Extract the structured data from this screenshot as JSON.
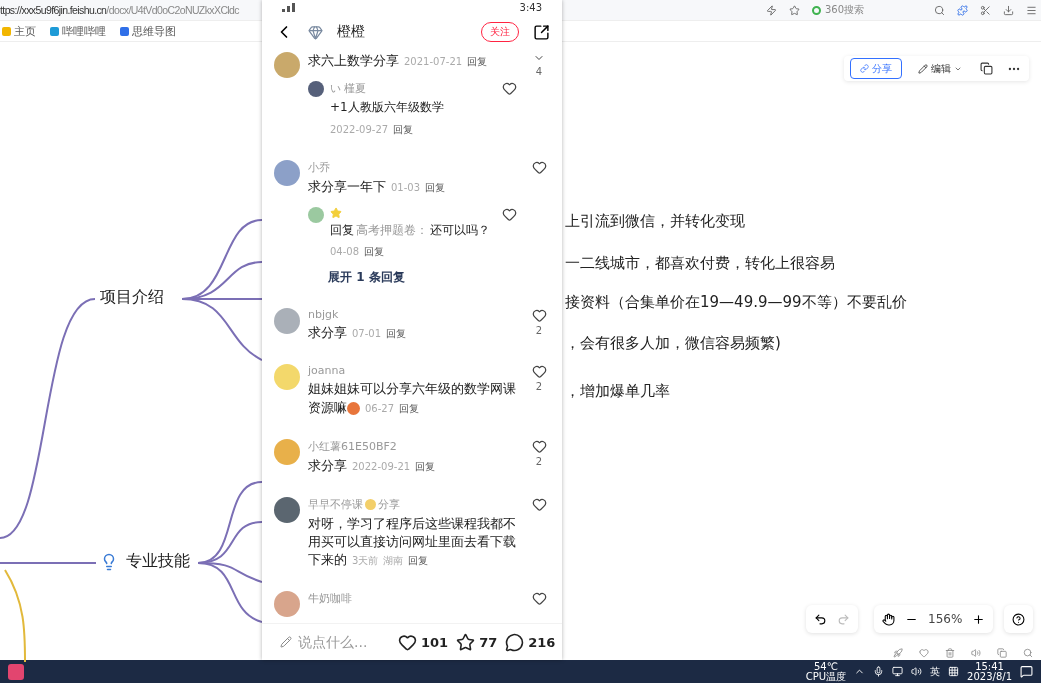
{
  "browser": {
    "url_host": "ttps://xxx5u9f6jin.feishu.cn",
    "url_path": "/docx/U4tVd0oC2oNUZkxXCldc",
    "search": "360搜索"
  },
  "bookmarks": [
    {
      "label": "主页",
      "color": "#f2b600"
    },
    {
      "label": "哔哩哔哩",
      "color": "#1e9bd7"
    },
    {
      "label": "思维导图",
      "color": "#2f6fe8"
    }
  ],
  "doc_toolbar": {
    "share": "分享",
    "edit": "编辑"
  },
  "mindmap": {
    "nodes": [
      {
        "label": "项目介绍",
        "kind": "plain"
      },
      {
        "label": "专业技能",
        "kind": "icon"
      }
    ],
    "lines": [
      "上引流到微信，并转化变现",
      "一二线城市，都喜欢付费，转化上很容易",
      "接资料（合集单价在19—49.9—99不等）不要乱价",
      "，会有很多人加，微信容易频繁)",
      "，增加爆单几率"
    ],
    "zoom": "156%"
  },
  "phone": {
    "time": "3:43",
    "title": "橙橙",
    "follow": "关注",
    "comments": [
      {
        "text": "求六上数学分享",
        "date": "2021-07-21",
        "reply": "回复",
        "likes": "4",
        "replies": [
          {
            "name": "い 槿夏",
            "text": "+1人教版六年级数学",
            "date": "2022-09-27",
            "reply": "回复"
          }
        ]
      },
      {
        "name": "小乔",
        "text": "求分享一年下",
        "date": "01-03",
        "reply": "回复",
        "replies": [
          {
            "prefix": "回复",
            "target": "高考押题卷：",
            "text": "还可以吗？",
            "date": "04-08",
            "reply": "回复"
          }
        ],
        "more": "展开 1 条回复"
      },
      {
        "name": "nbjgk",
        "text": "求分享",
        "date": "07-01",
        "reply": "回复",
        "likes": "2"
      },
      {
        "name": "joanna",
        "text": "姐妹姐妹可以分享六年级的数学网课资源嘛",
        "date": "06-27",
        "reply": "回复",
        "likes": "2"
      },
      {
        "name": "小红薯61E50BF2",
        "text": "求分享",
        "date": "2022-09-21",
        "reply": "回复",
        "likes": "2"
      },
      {
        "name": "早早不停课",
        "tag": "分享",
        "text": "对呀，学习了程序后这些课程我都不用买可以直接访问网址里面去看下载下来的",
        "date": "3天前",
        "place": "湖南",
        "reply": "回复"
      },
      {
        "name": "牛奶咖啡"
      }
    ],
    "input": {
      "placeholder": "说点什么..."
    },
    "likes": "101",
    "stars": "77",
    "comment_count": "216"
  },
  "taskbar": {
    "temp": "54℃",
    "temp_label": "CPU温度",
    "ime": "英",
    "time": "15:41",
    "date": "2023/8/1"
  }
}
